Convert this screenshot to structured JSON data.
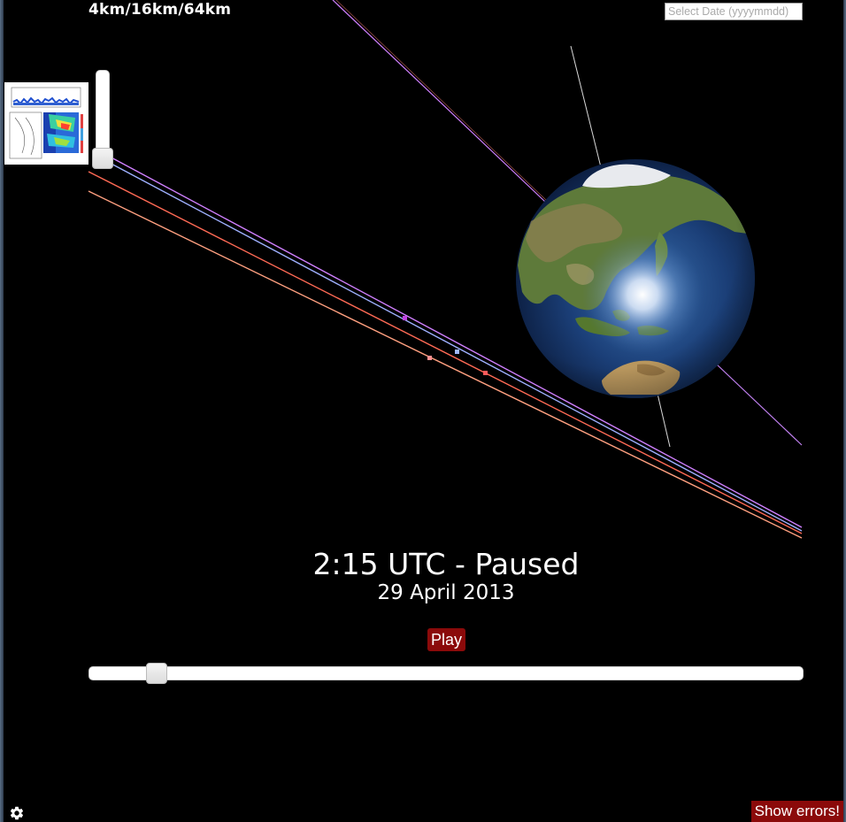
{
  "overlay": {
    "resolution_label": "4km/16km/64km"
  },
  "date_picker": {
    "placeholder": "Select Date (yyyymmdd)",
    "value": ""
  },
  "clock": {
    "time_status": "2:15 UTC - Paused",
    "date": "29 April 2013"
  },
  "controls": {
    "play_label": "Play",
    "show_errors_label": "Show errors!",
    "settings_icon": "gear-icon",
    "accent_color": "#8b0a0a"
  },
  "timeline": {
    "position_fraction": 0.095
  },
  "zoom": {
    "level_fraction": 0.0
  },
  "scene": {
    "background": "#000000",
    "globe": "earth-globe-asia-australia",
    "orbit_colors": [
      "#d080ff",
      "#9fb0ff",
      "#ff7060",
      "#ffa080",
      "#d9d9d9"
    ]
  }
}
